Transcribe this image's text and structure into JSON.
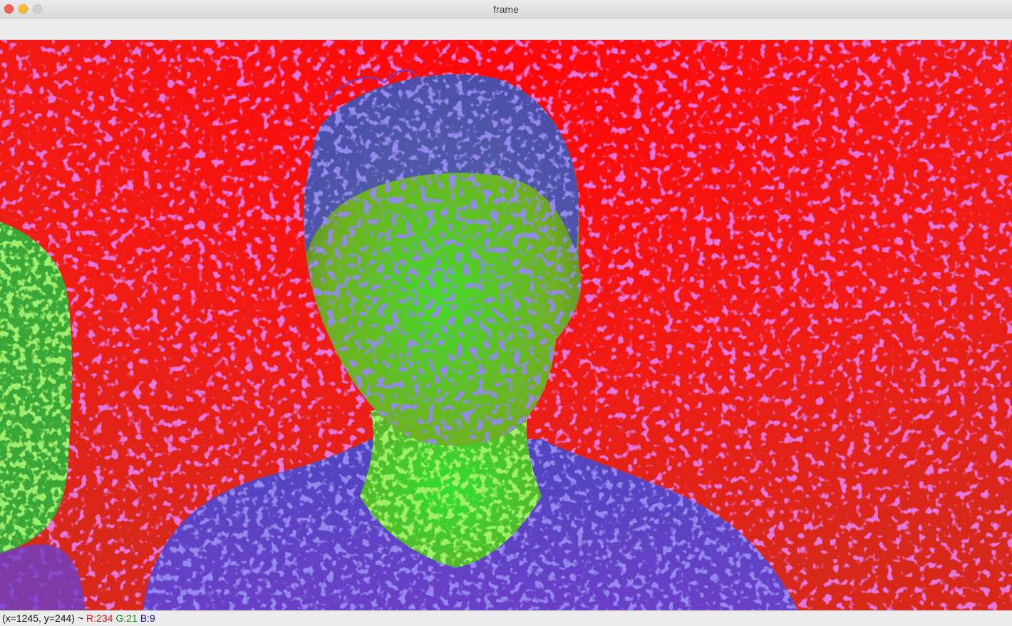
{
  "window": {
    "title": "frame"
  },
  "status": {
    "coords": "(x=1245, y=244) ~",
    "r": "R:234",
    "g": "G:21",
    "b": "B:9"
  },
  "colors": {
    "background_red": "#f21810",
    "figure_blue": "#5a3fd0",
    "figure_green": "#4fd02a",
    "speckle_magenta": "#c040e0"
  },
  "icons": {
    "close": "close-window-button",
    "minimize": "minimize-window-button",
    "zoom": "zoom-window-button"
  }
}
